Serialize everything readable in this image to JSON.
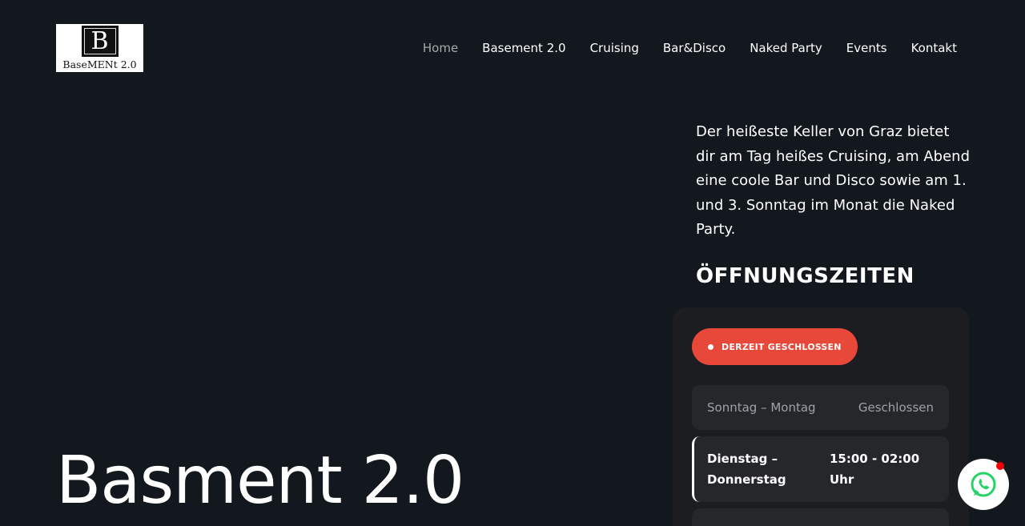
{
  "logo": {
    "letter": "B",
    "text": "BaseMENt 2.0"
  },
  "nav": {
    "items": [
      {
        "label": "Home",
        "active": true
      },
      {
        "label": "Basement 2.0",
        "active": false
      },
      {
        "label": "Cruising",
        "active": false
      },
      {
        "label": "Bar&Disco",
        "active": false
      },
      {
        "label": "Naked Party",
        "active": false
      },
      {
        "label": "Events",
        "active": false
      },
      {
        "label": "Kontakt",
        "active": false
      }
    ]
  },
  "hero": {
    "title": "Basment 2.0"
  },
  "intro": {
    "text": "Der heißeste Keller von Graz bietet dir am Tag heißes Cruising, am Abend eine coole Bar und Disco sowie am 1. und 3. Sonntag im Monat die Naked Party."
  },
  "hours": {
    "heading": "ÖFFNUNGSZEITEN",
    "status": "DERZEIT GESCHLOSSEN",
    "rows": [
      {
        "day": "Sonntag – Montag",
        "time": "Geschlossen"
      },
      {
        "day": "Dienstag – Donnerstag",
        "time": "15:00 - 02:00 Uhr"
      }
    ]
  },
  "colors": {
    "background": "#12181d",
    "card": "#1b1d20",
    "row": "#25272b",
    "status_badge": "#e8483a",
    "nav_active": "#a4a9ad",
    "whatsapp_green": "#25d366",
    "notification": "#f20000"
  },
  "icons": {
    "whatsapp": "whatsapp-icon"
  }
}
